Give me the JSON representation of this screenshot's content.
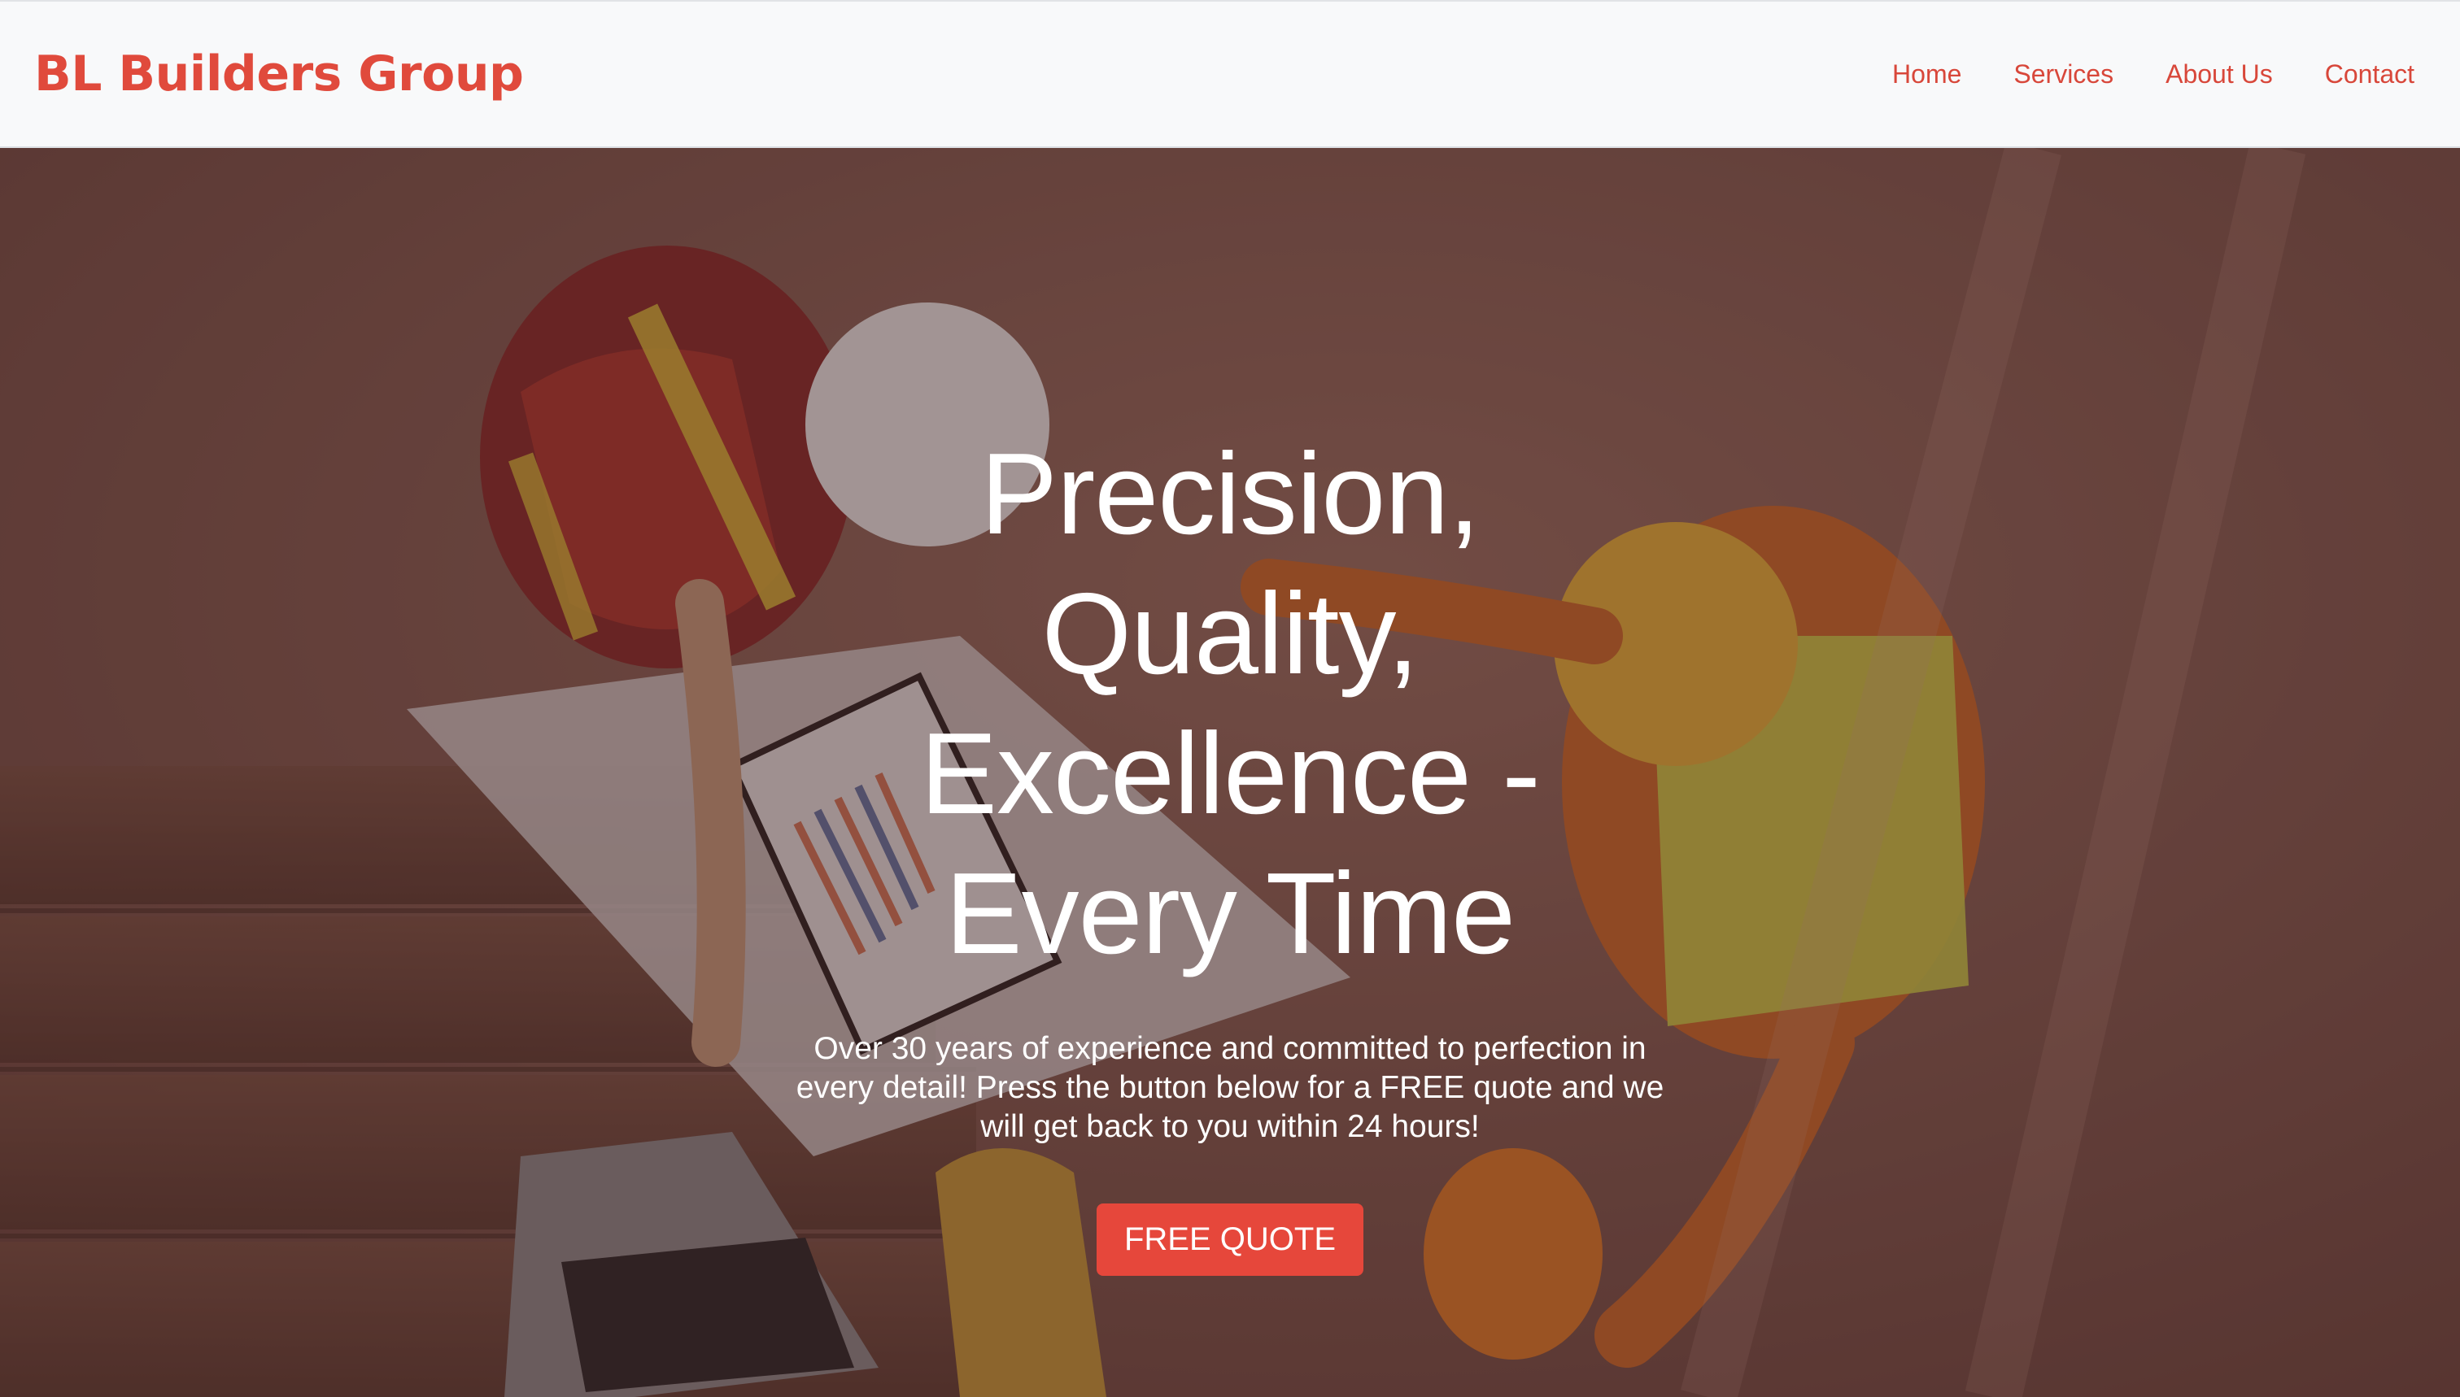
{
  "navbar": {
    "brand": "BL Builders Group",
    "links": [
      "Home",
      "Services",
      "About Us",
      "Contact"
    ]
  },
  "hero": {
    "title": "Precision, Quality, Excellence - Every Time",
    "subtitle": "Over 30 years of experience and committed to perfection in every detail! Press the button below for a FREE quote and we will get back to you within 24 hours!",
    "cta_label": "FREE QUOTE"
  },
  "colors": {
    "brand_red": "#e04a3c",
    "button_red": "#e6473b",
    "navbar_bg": "#f8f9fa",
    "hero_text": "#ffffff"
  }
}
